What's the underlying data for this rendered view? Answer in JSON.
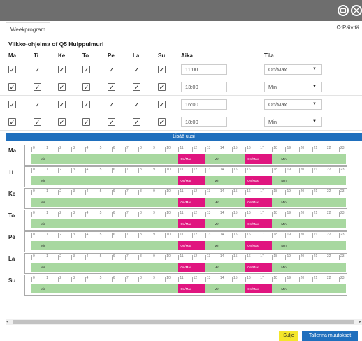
{
  "window": {
    "minimize_icon": "minus-circle-icon",
    "close_icon": "x-circle-icon"
  },
  "tabs": [
    {
      "label": "Weekprogram"
    }
  ],
  "refresh": {
    "icon": "refresh-icon",
    "label": "Päivitä"
  },
  "title": "Viikko-ohjelma of Q5 Huippuimuri",
  "columns": {
    "days": [
      "Ma",
      "Ti",
      "Ke",
      "To",
      "Pe",
      "La",
      "Su"
    ],
    "time": "Aika",
    "mode": "Tila"
  },
  "program_rows": [
    {
      "days_checked": [
        true,
        true,
        true,
        true,
        true,
        true,
        true
      ],
      "time": "11:00",
      "mode": "On/Max"
    },
    {
      "days_checked": [
        true,
        true,
        true,
        true,
        true,
        true,
        true
      ],
      "time": "13:00",
      "mode": "Min"
    },
    {
      "days_checked": [
        true,
        true,
        true,
        true,
        true,
        true,
        true
      ],
      "time": "16:00",
      "mode": "On/Max"
    },
    {
      "days_checked": [
        true,
        true,
        true,
        true,
        true,
        true,
        true
      ],
      "time": "18:00",
      "mode": "Min"
    }
  ],
  "add_button": "Lisää uusi",
  "timeline": {
    "hours": [
      "0",
      "1",
      "2",
      "3",
      "4",
      "5",
      "6",
      "7",
      "8",
      "9",
      "10",
      "11",
      "12",
      "13",
      "14",
      "15",
      "16",
      "17",
      "18",
      "19",
      "20",
      "21",
      "22",
      "23"
    ],
    "days": [
      {
        "label": "Ma",
        "segments": [
          {
            "mode": "Min",
            "start": 0,
            "end": 11
          },
          {
            "mode": "On/Max",
            "start": 11,
            "end": 13
          },
          {
            "mode": "Min",
            "start": 13,
            "end": 16
          },
          {
            "mode": "On/Max",
            "start": 16,
            "end": 18
          },
          {
            "mode": "Min",
            "start": 18,
            "end": 24
          }
        ]
      },
      {
        "label": "Ti",
        "segments": [
          {
            "mode": "Min",
            "start": 0,
            "end": 11
          },
          {
            "mode": "On/Max",
            "start": 11,
            "end": 13
          },
          {
            "mode": "Min",
            "start": 13,
            "end": 16
          },
          {
            "mode": "On/Max",
            "start": 16,
            "end": 18
          },
          {
            "mode": "Min",
            "start": 18,
            "end": 24
          }
        ]
      },
      {
        "label": "Ke",
        "segments": [
          {
            "mode": "Min",
            "start": 0,
            "end": 11
          },
          {
            "mode": "On/Max",
            "start": 11,
            "end": 13
          },
          {
            "mode": "Min",
            "start": 13,
            "end": 16
          },
          {
            "mode": "On/Max",
            "start": 16,
            "end": 18
          },
          {
            "mode": "Min",
            "start": 18,
            "end": 24
          }
        ]
      },
      {
        "label": "To",
        "segments": [
          {
            "mode": "Min",
            "start": 0,
            "end": 11
          },
          {
            "mode": "On/Max",
            "start": 11,
            "end": 13
          },
          {
            "mode": "Min",
            "start": 13,
            "end": 16
          },
          {
            "mode": "On/Max",
            "start": 16,
            "end": 18
          },
          {
            "mode": "Min",
            "start": 18,
            "end": 24
          }
        ]
      },
      {
        "label": "Pe",
        "segments": [
          {
            "mode": "Min",
            "start": 0,
            "end": 11
          },
          {
            "mode": "On/Max",
            "start": 11,
            "end": 13
          },
          {
            "mode": "Min",
            "start": 13,
            "end": 16
          },
          {
            "mode": "On/Max",
            "start": 16,
            "end": 18
          },
          {
            "mode": "Min",
            "start": 18,
            "end": 24
          }
        ]
      },
      {
        "label": "La",
        "segments": [
          {
            "mode": "Min",
            "start": 0,
            "end": 11
          },
          {
            "mode": "On/Max",
            "start": 11,
            "end": 13
          },
          {
            "mode": "Min",
            "start": 13,
            "end": 16
          },
          {
            "mode": "On/Max",
            "start": 16,
            "end": 18
          },
          {
            "mode": "Min",
            "start": 18,
            "end": 24
          }
        ]
      },
      {
        "label": "Su",
        "segments": [
          {
            "mode": "Min",
            "start": 0,
            "end": 11
          },
          {
            "mode": "On/Max",
            "start": 11,
            "end": 13
          },
          {
            "mode": "Min",
            "start": 13,
            "end": 16
          },
          {
            "mode": "On/Max",
            "start": 16,
            "end": 18
          },
          {
            "mode": "Min",
            "start": 18,
            "end": 24
          }
        ]
      }
    ]
  },
  "footer": {
    "close": "Sulje",
    "save": "Tallenna muutokset"
  },
  "colors": {
    "titlebar": "#6e6e6e",
    "accent": "#1f6fbd",
    "onmax": "#e0157f",
    "min": "#a8d8a0",
    "close_button": "#f4e62a"
  }
}
